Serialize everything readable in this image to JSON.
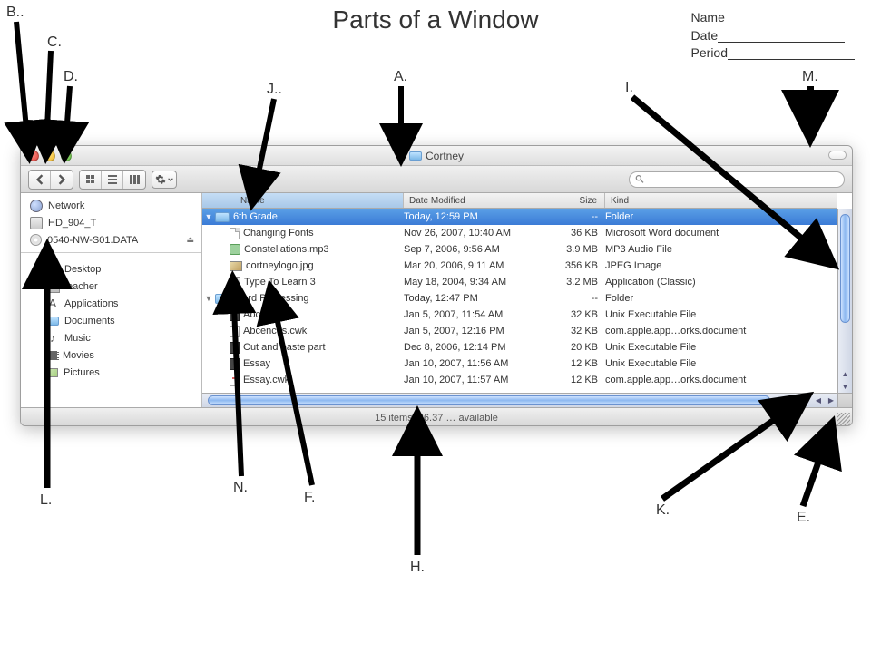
{
  "slide": {
    "title": "Parts of a Window",
    "info_labels": {
      "name": "Name",
      "date": "Date",
      "period": "Period"
    }
  },
  "labels": {
    "A": "A.",
    "B": "B..",
    "C": "C.",
    "D": "D.",
    "E": "E.",
    "F": "F.",
    "H": "H.",
    "I": "I.",
    "J": "J..",
    "K": "K.",
    "L": "L.",
    "M": "M.",
    "N": "N."
  },
  "finder": {
    "title": "Cortney",
    "status": "15 items, 26.37 … available",
    "search_placeholder": "",
    "columns": {
      "name": "Name",
      "date": "Date Modified",
      "size": "Size",
      "kind": "Kind"
    },
    "sidebar": {
      "top": [
        {
          "label": "Network",
          "icon": "globe"
        },
        {
          "label": "HD_904_T",
          "icon": "disk"
        },
        {
          "label": "0540-NW-S01.DATA",
          "icon": "cd",
          "ejectable": true
        }
      ],
      "places": [
        {
          "label": "Desktop",
          "icon": "folder"
        },
        {
          "label": "teacher",
          "icon": "home"
        },
        {
          "label": "Applications",
          "icon": "apps"
        },
        {
          "label": "Documents",
          "icon": "folder"
        },
        {
          "label": "Music",
          "icon": "music"
        },
        {
          "label": "Movies",
          "icon": "movie"
        },
        {
          "label": "Pictures",
          "icon": "pic"
        }
      ]
    },
    "rows": [
      {
        "indent": 0,
        "disclosure": "down",
        "icon": "folder",
        "name": "6th Grade",
        "date": "Today, 12:59 PM",
        "size": "--",
        "kind": "Folder",
        "selected": true
      },
      {
        "indent": 1,
        "icon": "doc",
        "name": "Changing Fonts",
        "date": "Nov 26, 2007, 10:40 AM",
        "size": "36 KB",
        "kind": "Microsoft Word document"
      },
      {
        "indent": 1,
        "icon": "mp3",
        "name": "Constellations.mp3",
        "date": "Sep 7, 2006, 9:56 AM",
        "size": "3.9 MB",
        "kind": "MP3 Audio File"
      },
      {
        "indent": 1,
        "icon": "img",
        "name": "cortneylogo.jpg",
        "date": "Mar 20, 2006, 9:11 AM",
        "size": "356 KB",
        "kind": "JPEG Image"
      },
      {
        "indent": 1,
        "icon": "app",
        "name": "Type To Learn 3",
        "date": "May 18, 2004, 9:34 AM",
        "size": "3.2 MB",
        "kind": "Application (Classic)"
      },
      {
        "indent": 0,
        "disclosure": "down",
        "icon": "folder",
        "name": "Word Processing",
        "date": "Today, 12:47 PM",
        "size": "--",
        "kind": "Folder"
      },
      {
        "indent": 1,
        "icon": "exec",
        "name": "Abcences",
        "date": "Jan 5, 2007, 11:54 AM",
        "size": "32 KB",
        "kind": "Unix Executable File"
      },
      {
        "indent": 1,
        "icon": "cwk",
        "name": "Abcences.cwk",
        "date": "Jan 5, 2007, 12:16 PM",
        "size": "32 KB",
        "kind": "com.apple.app…orks.document"
      },
      {
        "indent": 1,
        "icon": "exec",
        "name": "Cut and paste part",
        "date": "Dec 8, 2006, 12:14 PM",
        "size": "20 KB",
        "kind": "Unix Executable File"
      },
      {
        "indent": 1,
        "icon": "exec",
        "name": "Essay",
        "date": "Jan 10, 2007, 11:56 AM",
        "size": "12 KB",
        "kind": "Unix Executable File"
      },
      {
        "indent": 1,
        "icon": "cwk",
        "name": "Essay.cwk",
        "date": "Jan 10, 2007, 11:57 AM",
        "size": "12 KB",
        "kind": "com.apple.app…orks.document"
      }
    ]
  }
}
